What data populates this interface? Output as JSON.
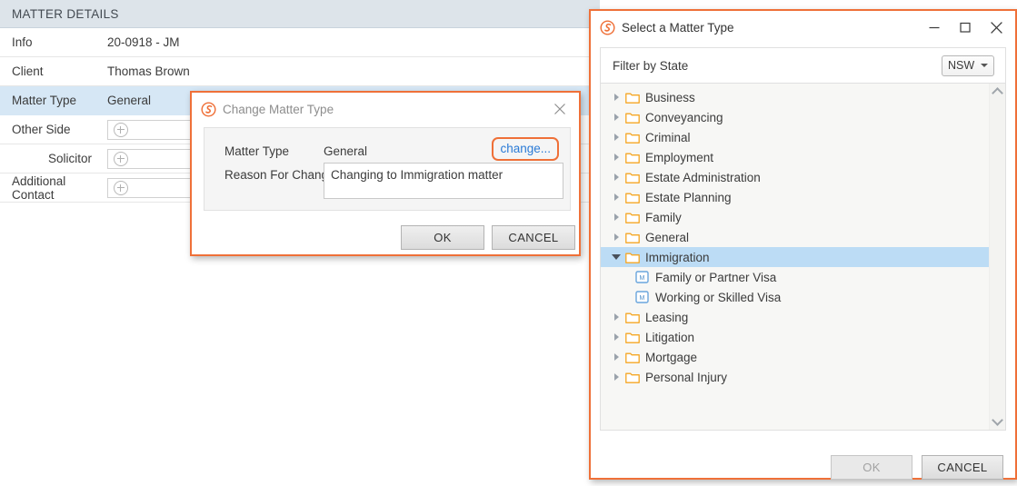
{
  "colors": {
    "accent_orange": "#ef7038",
    "header_blue_grey": "#dde4ea",
    "selection_blue": "#d6e7f5",
    "tree_selection_blue": "#bcdcf5",
    "link_blue": "#2b7bd6",
    "folder_orange": "#f5a623"
  },
  "matter_panel": {
    "header": "MATTER DETAILS",
    "rows": [
      {
        "label": "Info",
        "value": "20-0918 - JM",
        "type": "text",
        "selected": false,
        "indent": false
      },
      {
        "label": "Client",
        "value": "Thomas Brown",
        "type": "text",
        "selected": false,
        "indent": false
      },
      {
        "label": "Matter Type",
        "value": "General",
        "type": "text",
        "selected": true,
        "indent": false
      },
      {
        "label": "Other Side",
        "value": "",
        "type": "add",
        "selected": false,
        "indent": false
      },
      {
        "label": "Solicitor",
        "value": "",
        "type": "add",
        "selected": false,
        "indent": true
      },
      {
        "label": "Additional Contact",
        "value": "",
        "type": "add",
        "selected": false,
        "indent": false
      }
    ]
  },
  "change_dialog": {
    "title": "Change Matter Type",
    "logo_icon": "smokeball-logo-icon",
    "close_icon": "close-icon",
    "matter_type_label": "Matter Type",
    "matter_type_value": "General",
    "change_link": "change...",
    "reason_label": "Reason For Change",
    "reason_value": "Changing to Immigration matter",
    "reason_placeholder": "",
    "ok_label": "OK",
    "cancel_label": "CANCEL"
  },
  "select_dialog": {
    "title": "Select a Matter Type",
    "logo_icon": "smokeball-logo-icon",
    "minimize_icon": "minimize-icon",
    "maximize_icon": "maximize-icon",
    "close_icon": "close-icon",
    "filter_label": "Filter by State",
    "state_value": "NSW",
    "scrollbar_up_icon": "chevron-up-icon",
    "scrollbar_down_icon": "chevron-down-icon",
    "tree": [
      {
        "label": "Business",
        "level": 0,
        "state": "collapsed",
        "icon": "folder-icon",
        "selected": false
      },
      {
        "label": "Conveyancing",
        "level": 0,
        "state": "collapsed",
        "icon": "folder-icon",
        "selected": false
      },
      {
        "label": "Criminal",
        "level": 0,
        "state": "collapsed",
        "icon": "folder-icon",
        "selected": false
      },
      {
        "label": "Employment",
        "level": 0,
        "state": "collapsed",
        "icon": "folder-icon",
        "selected": false
      },
      {
        "label": "Estate Administration",
        "level": 0,
        "state": "collapsed",
        "icon": "folder-icon",
        "selected": false
      },
      {
        "label": "Estate Planning",
        "level": 0,
        "state": "collapsed",
        "icon": "folder-icon",
        "selected": false
      },
      {
        "label": "Family",
        "level": 0,
        "state": "collapsed",
        "icon": "folder-icon",
        "selected": false
      },
      {
        "label": "General",
        "level": 0,
        "state": "collapsed",
        "icon": "folder-icon",
        "selected": false
      },
      {
        "label": "Immigration",
        "level": 0,
        "state": "expanded",
        "icon": "folder-icon",
        "selected": true
      },
      {
        "label": "Family or Partner Visa",
        "level": 1,
        "state": "leaf",
        "icon": "matter-type-icon",
        "selected": false
      },
      {
        "label": "Working or Skilled Visa",
        "level": 1,
        "state": "leaf",
        "icon": "matter-type-icon",
        "selected": false
      },
      {
        "label": "Leasing",
        "level": 0,
        "state": "collapsed",
        "icon": "folder-icon",
        "selected": false
      },
      {
        "label": "Litigation",
        "level": 0,
        "state": "collapsed",
        "icon": "folder-icon",
        "selected": false
      },
      {
        "label": "Mortgage",
        "level": 0,
        "state": "collapsed",
        "icon": "folder-icon",
        "selected": false
      },
      {
        "label": "Personal Injury",
        "level": 0,
        "state": "collapsed",
        "icon": "folder-icon",
        "selected": false
      }
    ],
    "ok_label": "OK",
    "ok_disabled": true,
    "cancel_label": "CANCEL"
  }
}
